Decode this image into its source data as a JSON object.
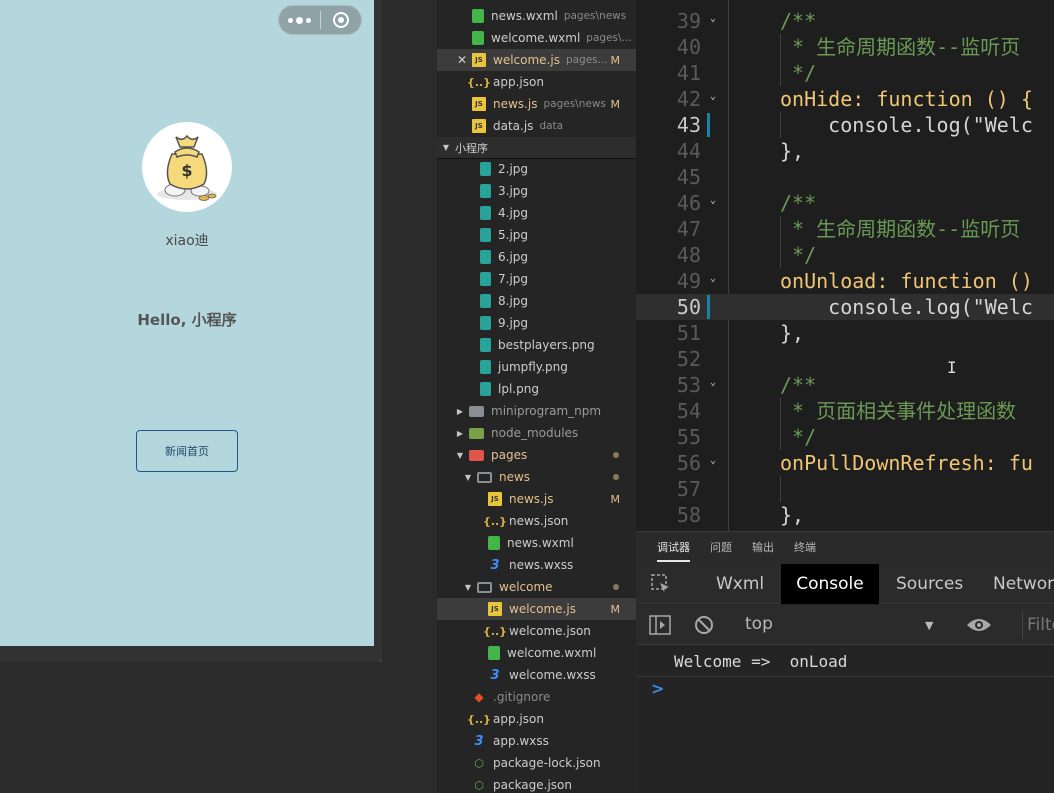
{
  "simulator": {
    "nickname": "xiao迪",
    "greeting": "Hello, 小程序",
    "news_button": "新闻首页",
    "bg_color": "#b4d6dd"
  },
  "file_tree": {
    "open_editors": [
      {
        "name": "news.wxml",
        "desc": "pages\\news",
        "icon": "wxml-icon"
      },
      {
        "name": "welcome.wxml",
        "desc": "pages\\w...",
        "icon": "wxml-icon"
      },
      {
        "name": "welcome.js",
        "desc": "pages...",
        "icon": "js-icon",
        "badge": "M"
      },
      {
        "name": "app.json",
        "desc": "",
        "icon": "json-icon"
      },
      {
        "name": "news.js",
        "desc": "pages\\news",
        "icon": "js-icon",
        "badge": "M"
      },
      {
        "name": "data.js",
        "desc": "data",
        "icon": "js-icon"
      }
    ],
    "section_title": "小程序",
    "images": [
      "2.jpg",
      "3.jpg",
      "4.jpg",
      "5.jpg",
      "6.jpg",
      "7.jpg",
      "8.jpg",
      "9.jpg",
      "bestplayers.png",
      "jumpfly.png",
      "lpl.png"
    ],
    "folders": {
      "miniprogram_npm": "miniprogram_npm",
      "node_modules": "node_modules",
      "pages": "pages",
      "news": "news",
      "welcome": "welcome"
    },
    "news_files": [
      {
        "name": "news.js",
        "icon": "js-icon",
        "badge": "M"
      },
      {
        "name": "news.json",
        "icon": "json-icon"
      },
      {
        "name": "news.wxml",
        "icon": "wxml-icon"
      },
      {
        "name": "news.wxss",
        "icon": "css-icon"
      }
    ],
    "welcome_files": [
      {
        "name": "welcome.js",
        "icon": "js-icon",
        "badge": "M"
      },
      {
        "name": "welcome.json",
        "icon": "json-icon"
      },
      {
        "name": "welcome.wxml",
        "icon": "wxml-icon"
      },
      {
        "name": "welcome.wxss",
        "icon": "css-icon"
      }
    ],
    "root_files": [
      {
        "name": ".gitignore",
        "icon": "git-icon"
      },
      {
        "name": "app.json",
        "icon": "json-icon"
      },
      {
        "name": "app.wxss",
        "icon": "css-icon"
      },
      {
        "name": "package-lock.json",
        "icon": "npm-icon"
      },
      {
        "name": "package.json",
        "icon": "npm-icon"
      }
    ]
  },
  "editor": {
    "lines": [
      {
        "n": "39",
        "text": "/**"
      },
      {
        "n": "40",
        "text": " * 生命周期函数--监听页"
      },
      {
        "n": "41",
        "text": " */"
      },
      {
        "n": "42",
        "text": "onHide: function () {"
      },
      {
        "n": "43",
        "text": "    console.log(\"Welc"
      },
      {
        "n": "44",
        "text": "},"
      },
      {
        "n": "45",
        "text": ""
      },
      {
        "n": "46",
        "text": "/**"
      },
      {
        "n": "47",
        "text": " * 生命周期函数--监听页"
      },
      {
        "n": "48",
        "text": " */"
      },
      {
        "n": "49",
        "text": "onUnload: function ()"
      },
      {
        "n": "50",
        "text": "    console.log(\"Welc"
      },
      {
        "n": "51",
        "text": "},"
      },
      {
        "n": "52",
        "text": ""
      },
      {
        "n": "53",
        "text": "/**"
      },
      {
        "n": "54",
        "text": " * 页面相关事件处理函数"
      },
      {
        "n": "55",
        "text": " */"
      },
      {
        "n": "56",
        "text": "onPullDownRefresh: fu"
      },
      {
        "n": "57",
        "text": ""
      },
      {
        "n": "58",
        "text": "},"
      }
    ]
  },
  "debugger": {
    "panel_tabs": [
      "调试器",
      "问题",
      "输出",
      "终端"
    ],
    "devtools_tabs": [
      "Wxml",
      "Console",
      "Sources",
      "Network"
    ],
    "active_devtools_tab": "Console",
    "context": "top",
    "filter_placeholder": "Filte",
    "log_message": "Welcome =>  onLoad",
    "prompt": ">"
  }
}
